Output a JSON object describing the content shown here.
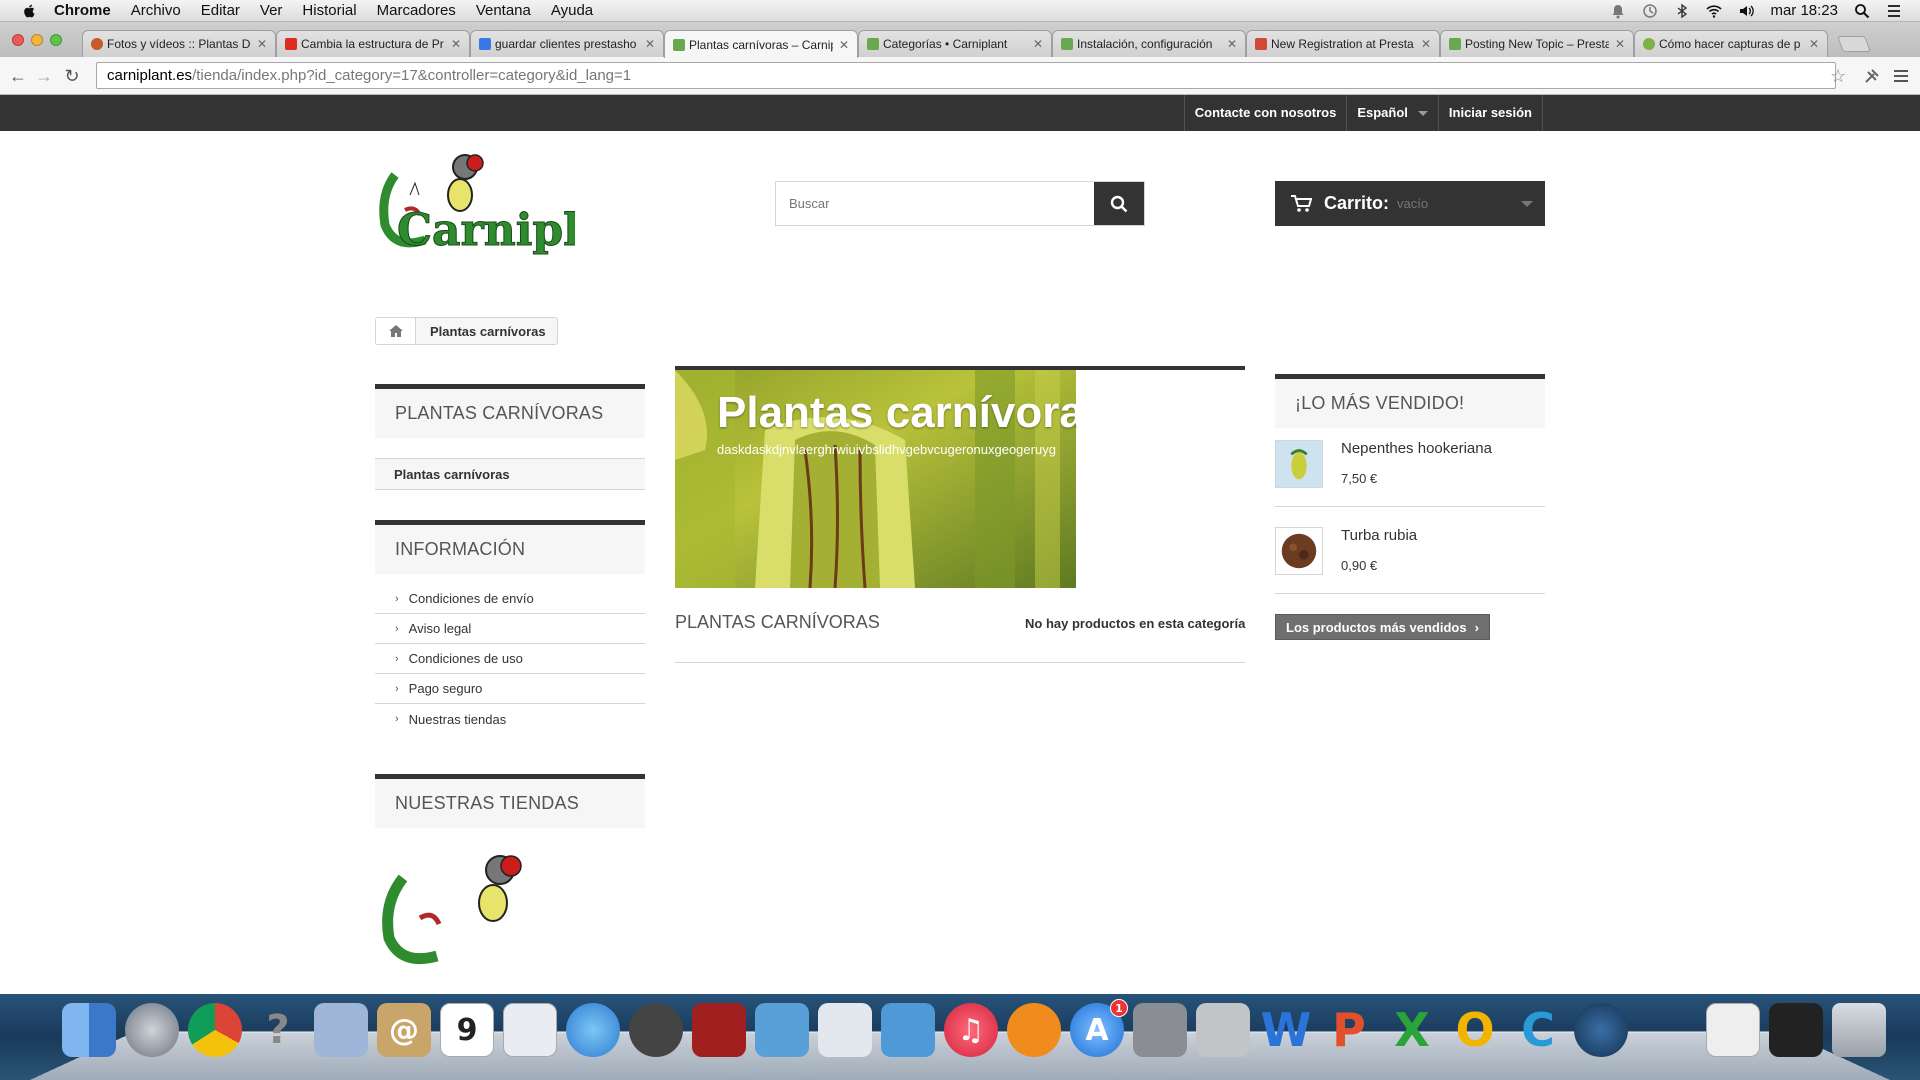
{
  "menubar": {
    "app": "Chrome",
    "items": [
      "Archivo",
      "Editar",
      "Ver",
      "Historial",
      "Marcadores",
      "Ventana",
      "Ayuda"
    ],
    "clock": "mar 18:23"
  },
  "tabs": [
    {
      "title": "Fotos y vídeos :: Plantas De",
      "favicon_color": "#c75a2a"
    },
    {
      "title": "Cambia la estructura de Pr",
      "favicon_color": "#e02b20"
    },
    {
      "title": "guardar clientes prestasho",
      "favicon_color": "#3b78e7"
    },
    {
      "title": "Plantas carnívoras – Carnip",
      "favicon_color": "#6aa84f",
      "active": true
    },
    {
      "title": "Categorías • Carniplant",
      "favicon_color": "#6aa84f"
    },
    {
      "title": "Instalación, configuración",
      "favicon_color": "#6aa84f"
    },
    {
      "title": "New Registration at Presta",
      "favicon_color": "#d14836"
    },
    {
      "title": "Posting New Topic – Presta",
      "favicon_color": "#6aa84f"
    },
    {
      "title": "Cómo hacer capturas de p",
      "favicon_color": "#7cb342"
    }
  ],
  "address": {
    "host": "carniplant.es",
    "path": "/tienda/index.php?id_category=17&controller=category&id_lang=1"
  },
  "site_nav": {
    "contact": "Contacte con nosotros",
    "language": "Español",
    "login": "Iniciar sesión"
  },
  "logo_text": "Carniplant",
  "search": {
    "placeholder": "Buscar"
  },
  "cart": {
    "label": "Carrito:",
    "status": "vacío"
  },
  "breadcrumb": {
    "current": "Plantas carnívoras"
  },
  "left": {
    "categories_title": "PLANTAS CARNÍVORAS",
    "category_item": "Plantas carnívoras",
    "info_title": "INFORMACIÓN",
    "info_links": [
      "Condiciones de envío",
      "Aviso legal",
      "Condiciones de uso",
      "Pago seguro",
      "Nuestras tiendas"
    ],
    "stores_title": "NUESTRAS TIENDAS"
  },
  "category": {
    "banner_title": "Plantas carnívoras",
    "banner_desc": "daskdaskdjnvlaerghrwiuivbslidhvgebvcugeronuxgeogeruyg",
    "heading": "PLANTAS CARNÍVORAS",
    "no_products": "No hay productos en esta categoría"
  },
  "bestsellers": {
    "title": "¡LO MÁS VENDIDO!",
    "items": [
      {
        "name": "Nepenthes hookeriana",
        "price": "7,50 €"
      },
      {
        "name": "Turba rubia",
        "price": "0,90 €"
      }
    ],
    "button": "Los productos más vendidos"
  },
  "dock": {
    "calendar_day": "9",
    "appstore_badge": "1"
  },
  "colors": {
    "dark": "#333333",
    "logo_green": "#2e8b2e"
  }
}
